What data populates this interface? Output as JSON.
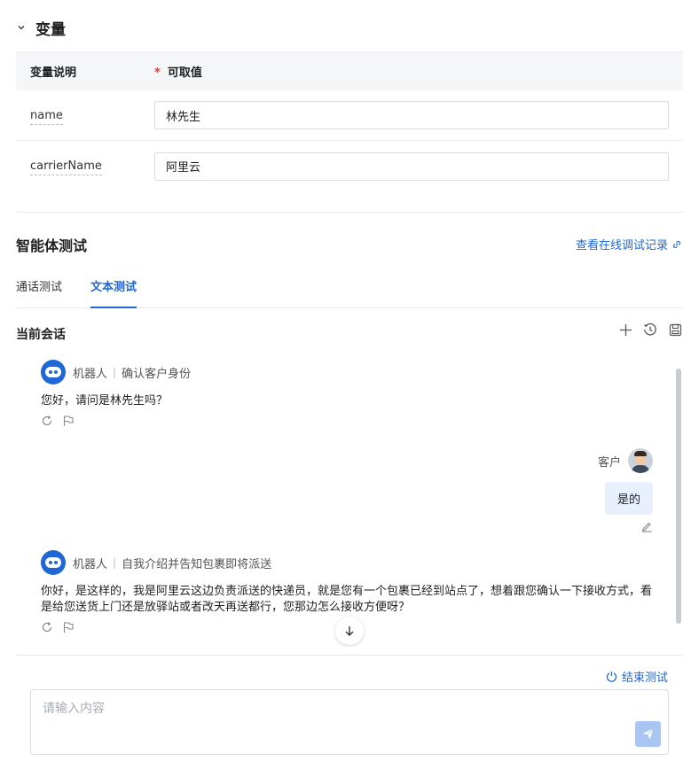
{
  "variables": {
    "title": "变量",
    "header": {
      "desc_col": "变量说明",
      "required_mark": "*",
      "value_col": "可取值"
    },
    "rows": [
      {
        "name": "name",
        "value": "林先生"
      },
      {
        "name": "carrierName",
        "value": "阿里云"
      }
    ]
  },
  "agent_test": {
    "title": "智能体测试",
    "view_log_link": "查看在线调试记录",
    "tabs": [
      {
        "label": "通话测试"
      },
      {
        "label": "文本测试"
      }
    ]
  },
  "conversation": {
    "title": "当前会话",
    "tools": {
      "add": "plus-icon",
      "history": "history-icon",
      "save": "save-icon"
    },
    "messages": [
      {
        "role": "bot",
        "name": "机器人",
        "stage": "确认客户身份",
        "text": "您好，请问是林先生吗？"
      },
      {
        "role": "user",
        "name": "客户",
        "text": "是的"
      },
      {
        "role": "bot",
        "name": "机器人",
        "stage": "自我介绍并告知包裹即将派送",
        "text": "你好，是这样的，我是阿里云这边负责派送的快递员，就是您有一个包裹已经到站点了，想着跟您确认一下接收方式，看是给您送货上门还是放驿站或者改天再送都行，您那边怎么接收方便呀？"
      }
    ]
  },
  "end_test_label": "结束测试",
  "input": {
    "placeholder": "请输入内容"
  },
  "colors": {
    "accent": "#1f66d6",
    "user_bubble": "#e8f0fd",
    "send_disabled": "#a9c6f2"
  }
}
